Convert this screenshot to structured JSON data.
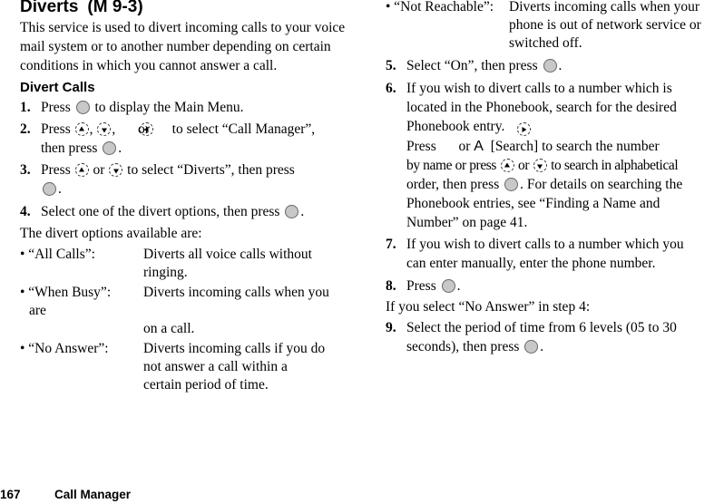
{
  "header": {
    "title": "Diverts",
    "menu_ref": "(M 9-3)"
  },
  "intro": "This service is used to divert incoming calls to your voice mail system or to another number depending on certain conditions in which you cannot answer a call.",
  "subheading": "Divert Calls",
  "steps": {
    "s1": {
      "num": "1.",
      "a": "Press",
      "b": "to display the Main Menu."
    },
    "s2": {
      "num": "2.",
      "a": "Press",
      "c1": ",",
      "c2": ",",
      "or": "or",
      "b": "to select “Call Manager”,",
      "c": "then press",
      "end": "."
    },
    "s3": {
      "num": "3.",
      "a": "Press",
      "or": "or",
      "b": "to select “Diverts”, then press",
      "end": "."
    },
    "s4": {
      "num": "4.",
      "a": "Select one of the divert options, then press",
      "end": "."
    },
    "s5": {
      "num": "5.",
      "a": "Select “On”, then press",
      "end": "."
    },
    "s6": {
      "num": "6.",
      "line1": "If you wish to divert calls to a number which is",
      "line2": "located in the Phonebook, search for the desired",
      "line3": "Phonebook entry.",
      "p_a": "Press",
      "p_or": "or",
      "p_key": "A",
      "p_b": "[Search] to search the number",
      "p_c": "by name or press",
      "p_or2": "or",
      "p_d": "to search in alphabetical",
      "p_e": "order, then press",
      "p_f": ". For details on searching the",
      "p_g": "Phonebook entries, see “Finding a Name and",
      "p_h": "Number” on page 41."
    },
    "s7": {
      "num": "7.",
      "line1": "If you wish to divert calls to a number which you",
      "line2": "can enter manually, enter the phone number."
    },
    "s8": {
      "num": "8.",
      "a": "Press",
      "end": "."
    },
    "s9": {
      "num": "9.",
      "line1": "Select the period of time from 6 levels (05 to 30",
      "line2": "seconds), then press",
      "end": "."
    }
  },
  "options_intro": "The divert options available are:",
  "options": [
    {
      "label": "•  “All Calls”:",
      "lines": [
        "Diverts all voice calls without",
        "ringing."
      ]
    },
    {
      "label": "•  “When Busy”:",
      "lines": [
        "Diverts incoming calls when you",
        "are",
        "on a call."
      ]
    },
    {
      "label": "•  “No Answer”:",
      "lines": [
        "Diverts incoming calls if you do",
        "not answer a call within a",
        "certain period of time."
      ]
    },
    {
      "label": "•  “Not Reachable”:",
      "lines": [
        "Diverts incoming calls when your",
        "phone is out of network service or",
        "switched off."
      ]
    }
  ],
  "no_answer_note": "If you select “No Answer” in step 4:",
  "footer": {
    "page_number": "167",
    "section": "Call Manager"
  }
}
